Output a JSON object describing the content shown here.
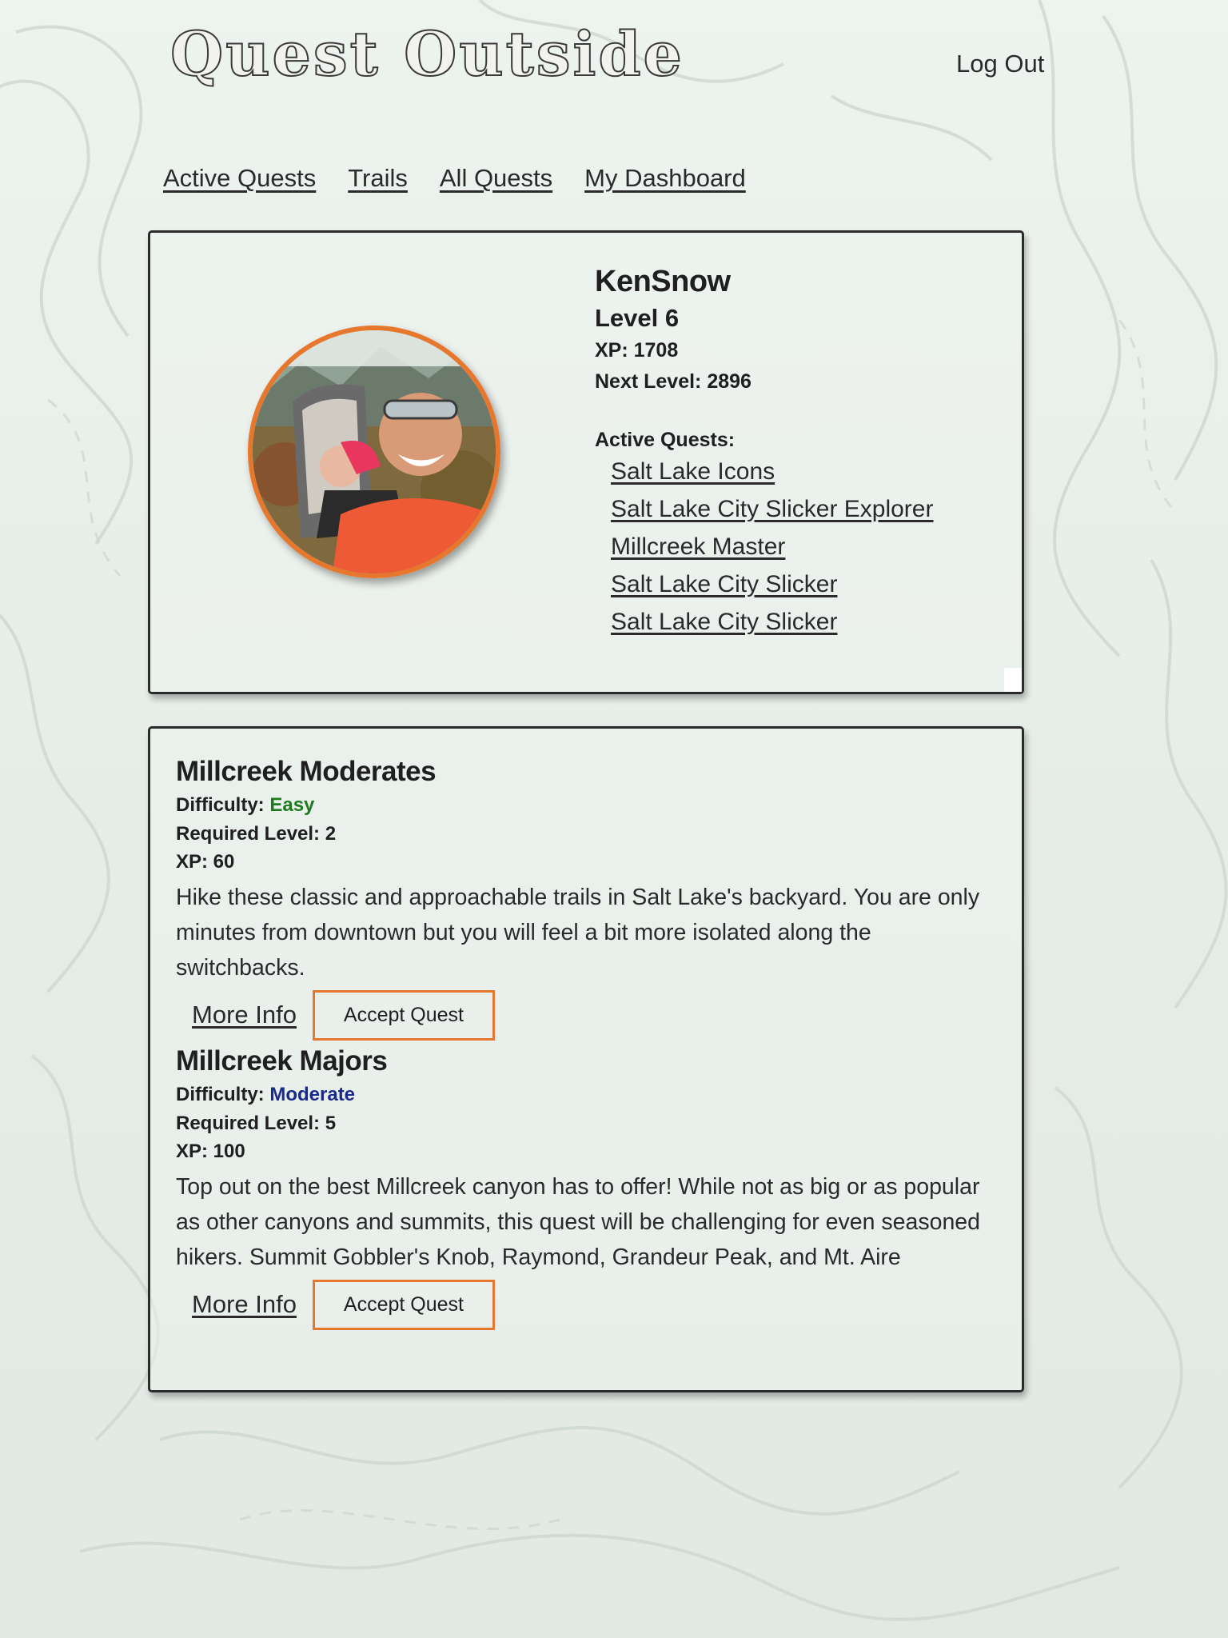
{
  "header": {
    "logo": "Quest Outside",
    "logout_label": "Log Out"
  },
  "nav": {
    "items": [
      "Active Quests",
      "Trails",
      "All Quests",
      "My Dashboard"
    ]
  },
  "profile": {
    "username": "KenSnow",
    "level": "Level 6",
    "xp": "XP: 1708",
    "next_level": "Next Level: 2896",
    "active_quests_label": "Active Quests:",
    "active_quests": [
      "Salt Lake Icons",
      "Salt Lake City Slicker Explorer",
      "Millcreek Master",
      "Salt Lake City Slicker",
      "Salt Lake City Slicker"
    ]
  },
  "quests": [
    {
      "title": "Millcreek Moderates",
      "difficulty_label": "Difficulty:",
      "difficulty": "Easy",
      "required_level": "Required Level: 2",
      "xp": "XP: 60",
      "description": "Hike these classic and approachable trails in Salt Lake's backyard. You are only minutes from downtown but you will feel a bit more isolated along the switchbacks.",
      "more_info_label": "More Info",
      "accept_label": "Accept Quest"
    },
    {
      "title": "Millcreek Majors",
      "difficulty_label": "Difficulty:",
      "difficulty": "Moderate",
      "required_level": "Required Level: 5",
      "xp": "XP: 100",
      "description": "Top out on the best Millcreek canyon has to offer! While not as big or as popular as other canyons and summits, this quest will be challenging for even seasoned hikers. Summit Gobbler's Knob, Raymond, Grandeur Peak, and Mt. Aire",
      "more_info_label": "More Info",
      "accept_label": "Accept Quest"
    }
  ],
  "colors": {
    "accent": "#e8772e",
    "easy": "#1e7a1e",
    "moderate": "#1a2a8a",
    "background": "#e7eee9"
  }
}
